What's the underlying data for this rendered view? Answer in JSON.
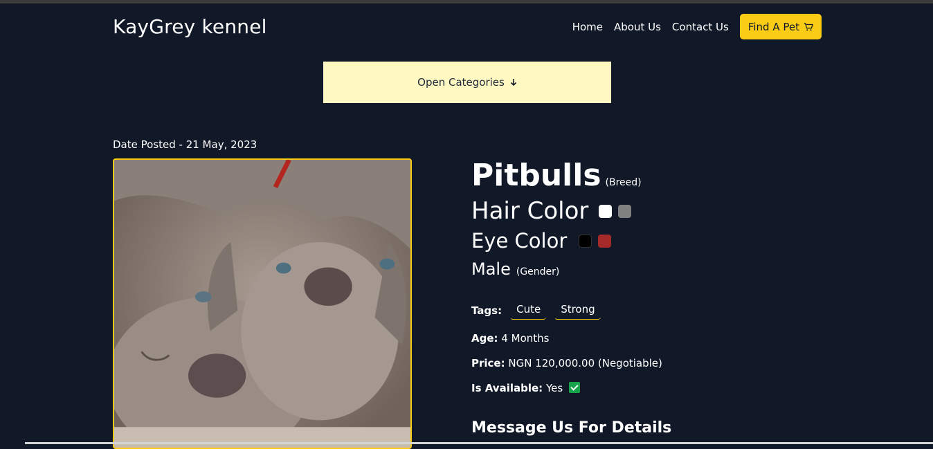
{
  "brand": "KayGrey kennel",
  "nav": {
    "home": "Home",
    "about": "About Us",
    "contact": "Contact Us",
    "find_pet": "Find A Pet",
    "find_pet_icon": "cart-icon"
  },
  "categories": {
    "label": "Open Categories",
    "icon": "arrow-down-icon"
  },
  "date_posted": "Date Posted - 21 May, 2023",
  "pet": {
    "breed": "Pitbulls",
    "breed_suffix": "(Breed)",
    "hair_color_label": "Hair Color",
    "hair_colors": [
      "#ffffff",
      "#808080"
    ],
    "eye_color_label": "Eye Color",
    "eye_colors": [
      "#000000",
      "#a52a2a"
    ],
    "gender": "Male",
    "gender_suffix": "(Gender)",
    "tags_label": "Tags:",
    "tags": [
      "Cute",
      "Strong"
    ],
    "age_label": "Age:",
    "age": "4 Months",
    "price_label": "Price:",
    "price": "NGN 120,000.00 (Negotiable)",
    "available_label": "Is Available:",
    "available": "Yes"
  },
  "message_heading": "Message Us For Details",
  "colors": {
    "background": "#111827",
    "accent": "#facc15",
    "categories_bg": "#fef9c3"
  }
}
